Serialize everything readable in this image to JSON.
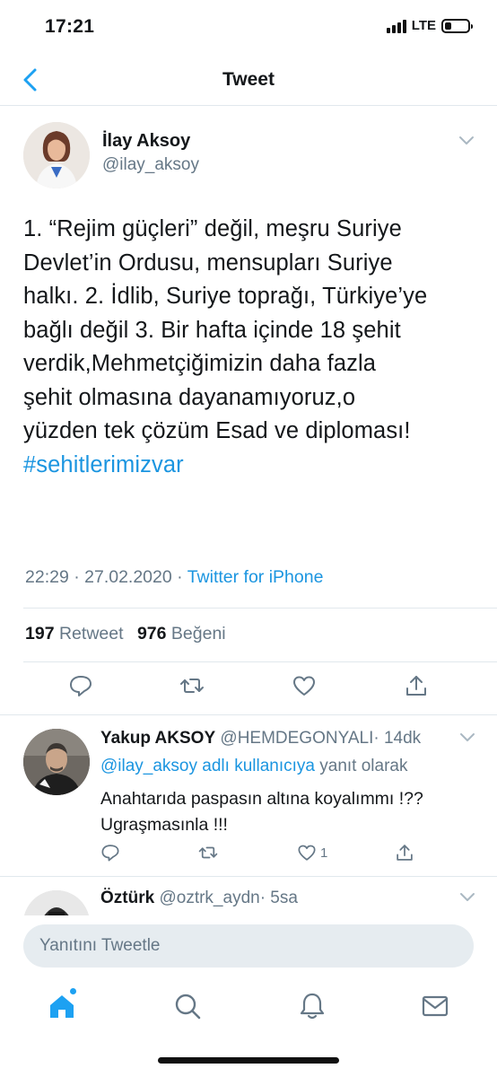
{
  "status": {
    "time": "17:21",
    "network": "LTE",
    "battery_level": 0.3
  },
  "nav": {
    "title": "Tweet",
    "back_icon": "chevron-left-icon"
  },
  "tweet": {
    "author_name": "İlay Aksoy",
    "author_handle": "@ilay_aksoy",
    "text_lines": [
      "1. “Rejim güçleri” değil, meşru Suriye",
      "Devlet’in Ordusu, mensupları Suriye",
      "halkı. 2. İdlib, Suriye toprağı, Türkiye’ye",
      "bağlı değil  3. Bir hafta içinde 18 şehit",
      "verdik,Mehmetçiğimizin daha fazla",
      "şehit olmasına dayanamıyoruz,o",
      "yüzden tek çözüm Esad ve diploması!"
    ],
    "hashtag": "#sehitlerimizvar",
    "timestamp": "22:29 · 27.02.2020 · ",
    "source": "Twitter for iPhone",
    "retweet_count": "197",
    "retweet_label": "Retweet",
    "like_count": "976",
    "like_label": "Beğeni"
  },
  "replies": [
    {
      "name": "Yakup AKSOY",
      "handle": "@HEMDEGONYALI",
      "time": "· 14dk",
      "reply_to_mention": "@ilay_aksoy adlı kullanıcıya",
      "reply_to_suffix": " yanıt olarak",
      "text_lines": [
        "Anahtarıda paspasın altına koyalımmı !??",
        "Ugraşmasınla !!!"
      ],
      "like_count": "1"
    },
    {
      "name": "Öztürk",
      "handle": "@oztrk_aydn",
      "time": "· 5sa"
    }
  ],
  "composer": {
    "placeholder": "Yanıtını Tweetle"
  },
  "colors": {
    "accent": "#1da1f2",
    "link": "#1b95e0",
    "muted": "#657786",
    "divider": "#e1e8ed",
    "composer_bg": "#e6ecf0"
  },
  "tabs": [
    "home-icon",
    "search-icon",
    "notifications-icon",
    "messages-icon"
  ]
}
